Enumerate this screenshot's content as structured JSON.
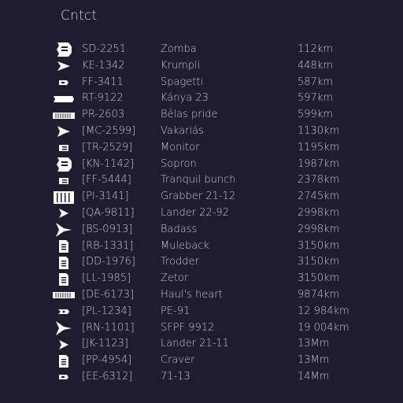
{
  "title": "Cntct",
  "colors": {
    "background": "#1e1c2e",
    "text": "#c8c8d2",
    "icon": "#ffffff"
  },
  "contacts": [
    {
      "icon": "cargo-pod-large-icon",
      "code": "SD-2251",
      "name": "Zomba",
      "distance": "112km"
    },
    {
      "icon": "fighter-ship-icon",
      "code": "KE-1342",
      "name": "Krumpli",
      "distance": "448km"
    },
    {
      "icon": "shuttle-small-icon",
      "code": "FF-3411",
      "name": "Spagetti",
      "distance": "587km"
    },
    {
      "icon": "hauler-long-icon",
      "code": "RT-9122",
      "name": "Kánya 23",
      "distance": "597km"
    },
    {
      "icon": "freighter-container-icon",
      "code": "PR-2603",
      "name": "Bélas pride",
      "distance": "599km"
    },
    {
      "icon": "interceptor-ship-icon",
      "code": "[MC-2599]",
      "name": "Vakariás",
      "distance": "1130km"
    },
    {
      "icon": "drone-box-icon",
      "code": "[TR-2529]",
      "name": "Monitor",
      "distance": "1195km"
    },
    {
      "icon": "cargo-pod-large-icon",
      "code": "[KN-1142]",
      "name": "Sopron",
      "distance": "1987km"
    },
    {
      "icon": "drone-box-icon",
      "code": "[FF-5444]",
      "name": "Tranquil bunch",
      "distance": "2378km"
    },
    {
      "icon": "grabber-station-icon",
      "code": "[PI-3141]",
      "name": "Grabber 21-12",
      "distance": "2745km"
    },
    {
      "icon": "lander-ship-icon",
      "code": "[QA-9811]",
      "name": "Lander 22-92",
      "distance": "2998km"
    },
    {
      "icon": "winged-ship-icon",
      "code": "[BS-0913]",
      "name": "Badass",
      "distance": "2998km"
    },
    {
      "icon": "data-tablet-icon",
      "code": "[RB-1331]",
      "name": "Muleback",
      "distance": "3150km"
    },
    {
      "icon": "data-tablet-icon",
      "code": "[DD-1976]",
      "name": "Trodder",
      "distance": "3150km"
    },
    {
      "icon": "data-tablet-icon",
      "code": "[LL-1985]",
      "name": "Zetor",
      "distance": "3150km"
    },
    {
      "icon": "freighter-container-icon",
      "code": "[DE-6173]",
      "name": "Haul's heart",
      "distance": "9874km"
    },
    {
      "icon": "probe-small-icon",
      "code": "[PL-1234]",
      "name": "PE-91",
      "distance": "12 984km"
    },
    {
      "icon": "winged-ship-icon",
      "code": "[RN-1101]",
      "name": "SFPF 9912",
      "distance": "19 004km"
    },
    {
      "icon": "lander-ship-icon",
      "code": "[JK-1123]",
      "name": "Lander 21-11",
      "distance": "13Mm"
    },
    {
      "icon": "data-tablet-icon",
      "code": "[PP-4954]",
      "name": "Craver",
      "distance": "13Mm"
    },
    {
      "icon": "shuttle-small-icon",
      "code": "[EE-6312]",
      "name": "71-13",
      "distance": "14Mm"
    }
  ]
}
